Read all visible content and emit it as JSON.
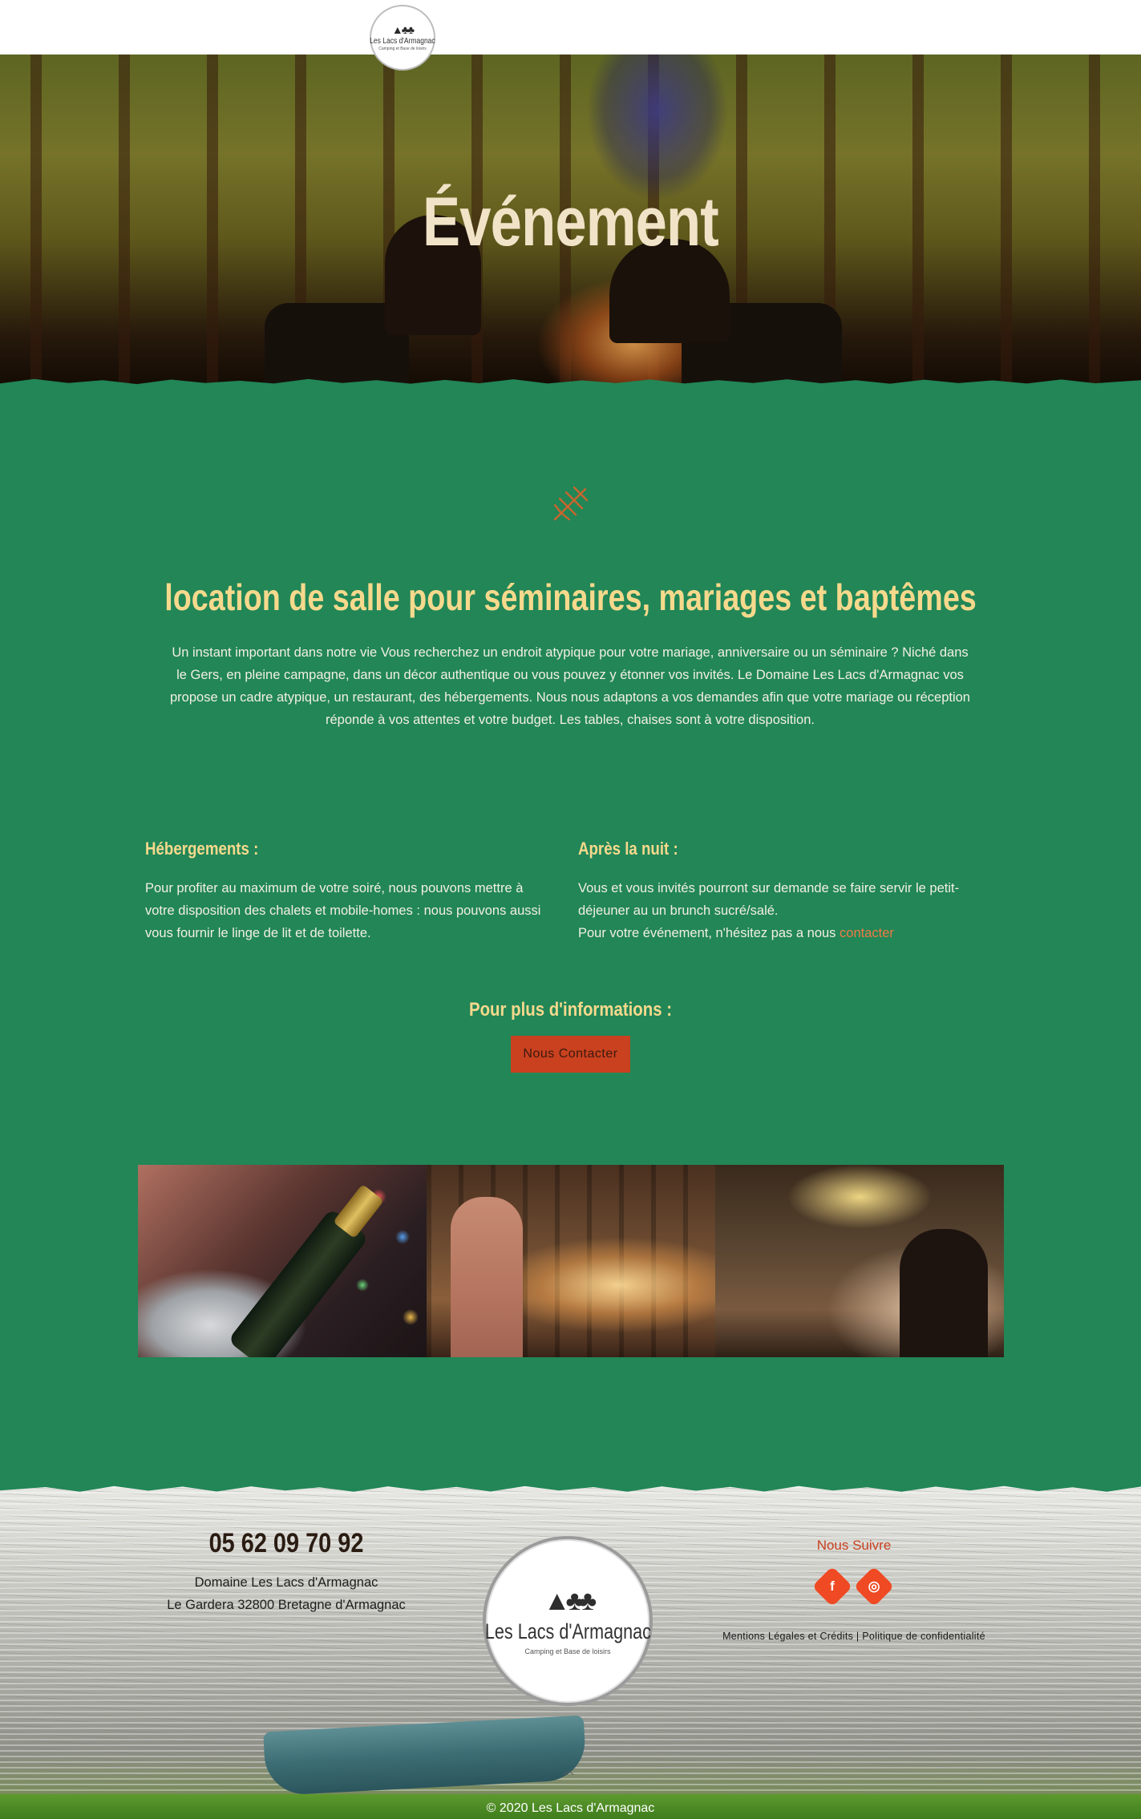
{
  "header": {
    "logo_name": "Les Lacs d'Armagnac",
    "logo_sub": "Camping et Base de loisirs"
  },
  "hero": {
    "title": "Événement"
  },
  "intro": {
    "title": "location de salle pour séminaires, mariages et baptêmes",
    "text": "Un instant important dans notre vie Vous recherchez un endroit atypique pour votre mariage, anniversaire ou un séminaire ? Niché dans le Gers, en pleine campagne, dans un décor authentique ou vous pouvez y étonner vos invités. Le Domaine Les Lacs d'Armagnac vos propose un cadre atypique, un restaurant, des hébergements. Nous nous adaptons a vos demandes afin que votre mariage ou réception réponde à vos attentes et votre budget. Les tables, chaises sont à votre disposition."
  },
  "columns": {
    "left": {
      "title": "Hébergements :",
      "text": "Pour profiter au maximum de votre soiré, nous pouvons mettre à votre disposition des chalets et mobile-homes : nous pouvons aussi vous fournir le linge de lit et de toilette."
    },
    "right": {
      "title": "Après la nuit :",
      "text": "Vous et vous invités pourront sur demande se faire servir le petit-déjeuner au un brunch sucré/salé.",
      "text2": "Pour votre événement, n'hésitez pas a nous",
      "link": "contacter"
    }
  },
  "cta": {
    "title": "Pour plus d'informations :",
    "button": "Nous Contacter"
  },
  "footer": {
    "phone": "05 62 09 70 92",
    "address_line1": "Domaine Les Lacs d'Armagnac",
    "address_line2": "Le Gardera 32800 Bretagne d'Armagnac",
    "logo_name": "Les Lacs d'Armagnac",
    "logo_sub": "Camping et Base de loisirs",
    "follow": "Nous Suivre",
    "facebook_glyph": "f",
    "instagram_glyph": "◎",
    "legal_mentions": "Mentions Légales et Crédits",
    "legal_sep": "|",
    "legal_privacy": "Politique de confidentialité",
    "copyright": "© 2020 Les Lacs d'Armagnac"
  },
  "icons": {
    "header_trees": "mountain-trees-icon",
    "deco": "branch-icon",
    "facebook": "facebook-icon",
    "instagram": "instagram-icon",
    "scroll_up": "chevron-up-icon"
  },
  "colors": {
    "page_green": "#228657",
    "title_yellow": "#f6d98c",
    "accent_orange": "#c9411f",
    "social_orange": "#ef4a23"
  }
}
